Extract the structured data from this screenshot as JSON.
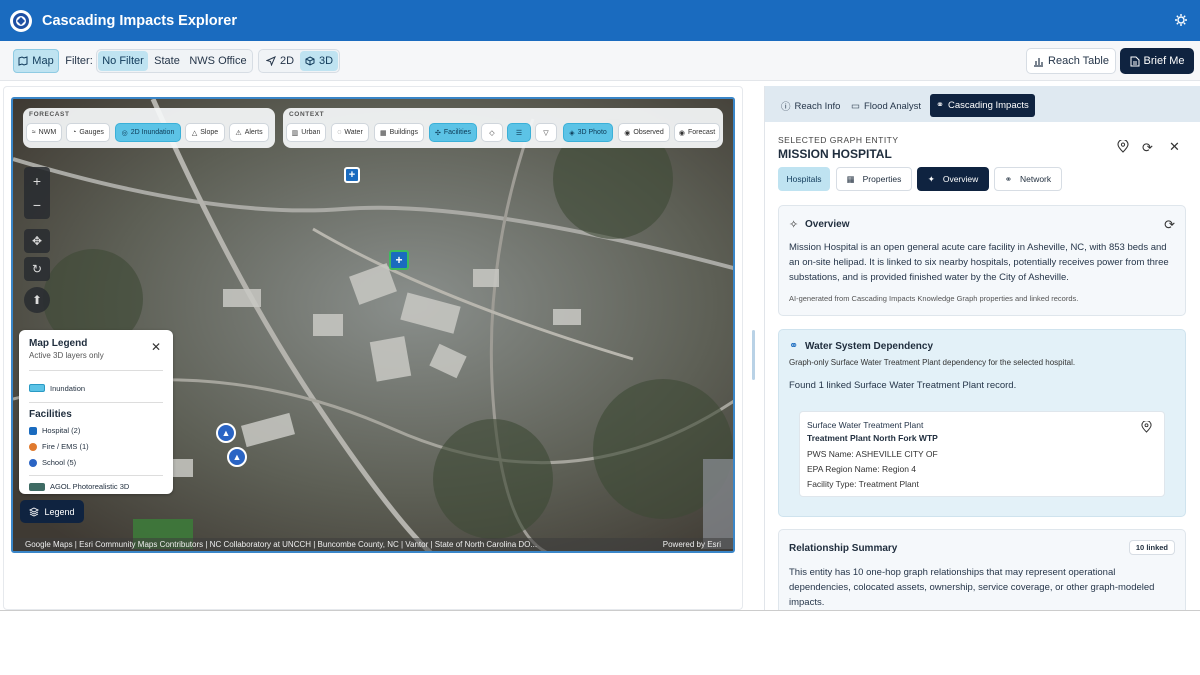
{
  "header": {
    "title": "Cascading Impacts Explorer",
    "settings_icon": "gear-icon",
    "logo_icon": "agency-logo-icon"
  },
  "toolbar": {
    "map_label": "Map",
    "filter_label": "Filter:",
    "filters": [
      "No Filter",
      "State",
      "NWS Office"
    ],
    "view2d": "2D",
    "view3d": "3D",
    "reach_table": "Reach Table",
    "brief_me": "Brief Me"
  },
  "map": {
    "forecast_label": "FORECAST",
    "forecast_chips": [
      "NWM",
      "Gauges",
      "2D Inundation",
      "Slope",
      "Alerts"
    ],
    "context_label": "CONTEXT",
    "context_chips": [
      "Urban",
      "Water",
      "Buildings",
      "Facilities"
    ],
    "photo_chips": [
      "3D Photo",
      "Observed",
      "Forecast"
    ],
    "attribution": "Google Maps | Esri Community Maps Contributors | NC Collaboratory at UNCCH | Buncombe County, NC | Vantor | State of North Carolina DO...",
    "powered_by": "Powered by Esri",
    "legend": {
      "title": "Map Legend",
      "subtitle": "Active 3D layers only",
      "inundation": "Inundation",
      "facilities_heading": "Facilities",
      "items": [
        "Hospital (2)",
        "Fire / EMS (1)",
        "School (5)"
      ],
      "photorealistic": "AGOL Photorealistic 3D"
    },
    "legend_button": "Legend"
  },
  "panel": {
    "tabs": [
      "Reach Info",
      "Flood Analyst",
      "Cascading Impacts"
    ],
    "entity_label": "SELECTED GRAPH ENTITY",
    "entity_name": "MISSION HOSPITAL",
    "subtabs": [
      "Hospitals",
      "Properties",
      "Overview",
      "Network"
    ],
    "overview": {
      "title": "Overview",
      "text": "Mission Hospital is an open general acute care facility in Asheville, NC, with 853 beds and an on-site helipad. It is linked to six nearby hospitals, potentially receives power from three substations, and is provided finished water by the City of Asheville.",
      "note": "AI-generated from Cascading Impacts Knowledge Graph properties and linked records."
    },
    "water": {
      "title": "Water System Dependency",
      "subtitle": "Graph-only Surface Water Treatment Plant dependency for the selected hospital.",
      "found": "Found 1 linked Surface Water Treatment Plant record.",
      "record": {
        "type": "Surface Water Treatment Plant",
        "name": "Treatment Plant North Fork WTP",
        "pws_label": "PWS Name:",
        "pws_value": "ASHEVILLE CITY OF",
        "epa_label": "EPA Region Name:",
        "epa_value": "Region 4",
        "fac_label": "Facility Type:",
        "fac_value": "Treatment Plant"
      }
    },
    "relationship": {
      "title": "Relationship Summary",
      "badge": "10 linked",
      "text": "This entity has 10 one-hop graph relationships that may represent operational dependencies, colocated assets, ownership, service coverage, or other graph-modeled impacts."
    }
  },
  "colors": {
    "header": "#1a6bbf",
    "accent": "#5cc3e6",
    "dark": "#0f2340",
    "hospital": "#1a6bbf",
    "fire": "#e07a2e",
    "school": "#2a64c4"
  }
}
